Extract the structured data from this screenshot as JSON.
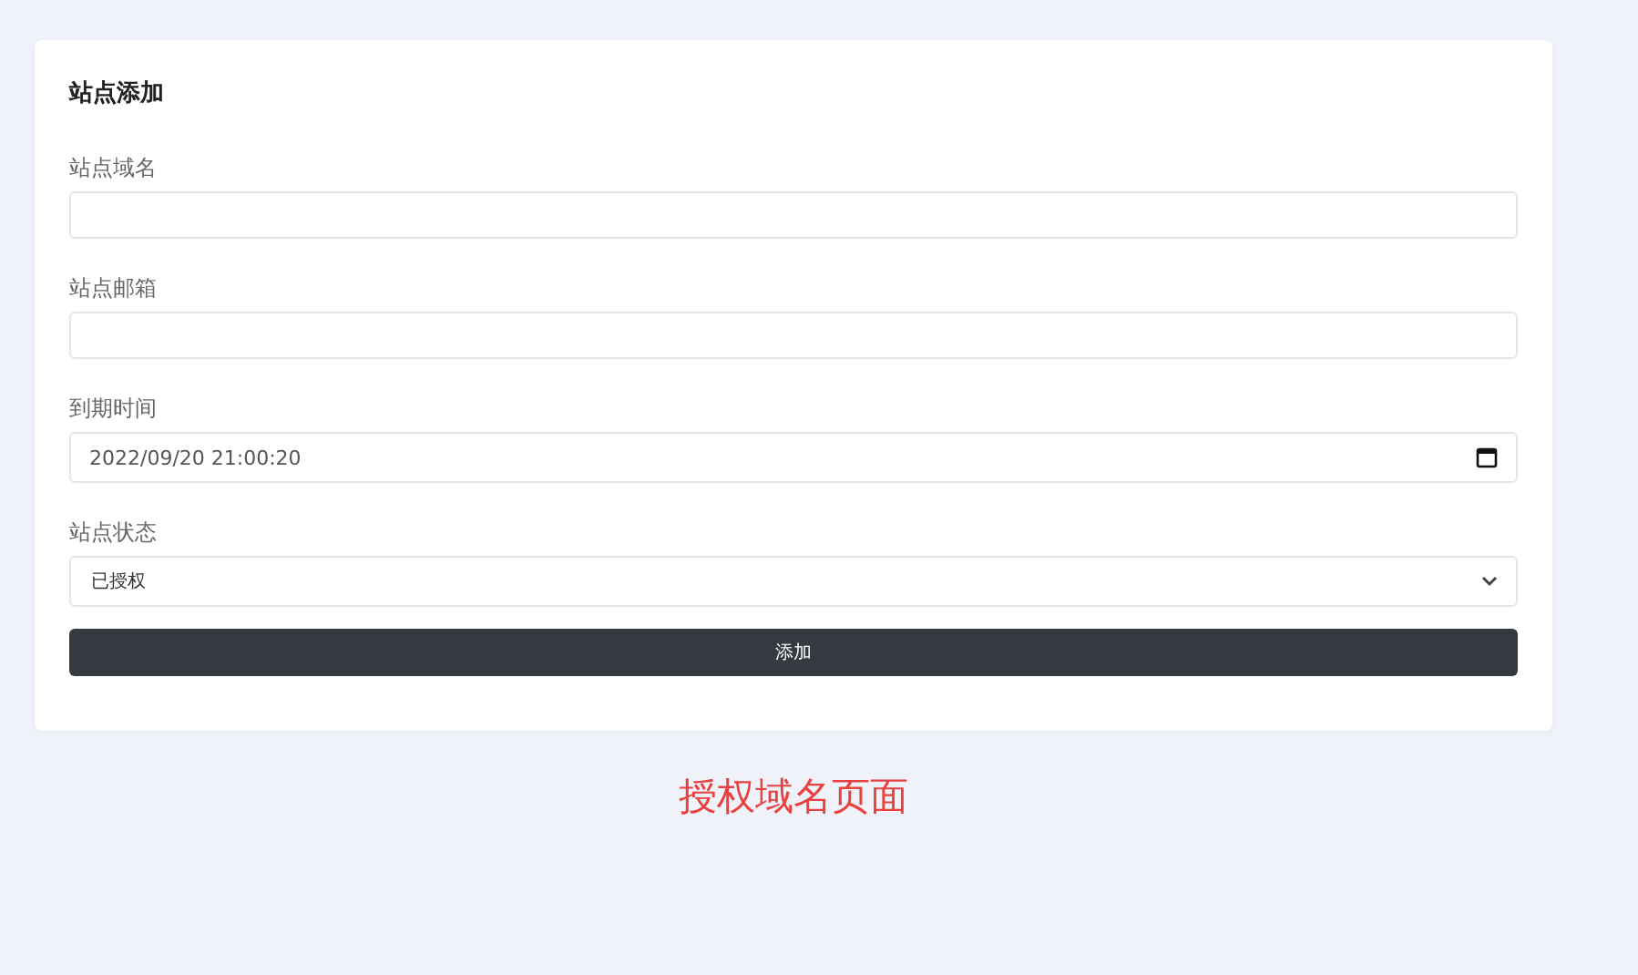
{
  "card": {
    "title": "站点添加",
    "fields": [
      {
        "kind": "text",
        "label": "站点域名"
      },
      {
        "kind": "text",
        "label": "站点邮箱"
      },
      {
        "kind": "date",
        "label": "到期时间",
        "value": "2022/09/20 21:00:20"
      },
      {
        "kind": "select",
        "label": "站点状态",
        "value": "已授权"
      }
    ],
    "button": "添加"
  },
  "caption": "授权域名页面"
}
